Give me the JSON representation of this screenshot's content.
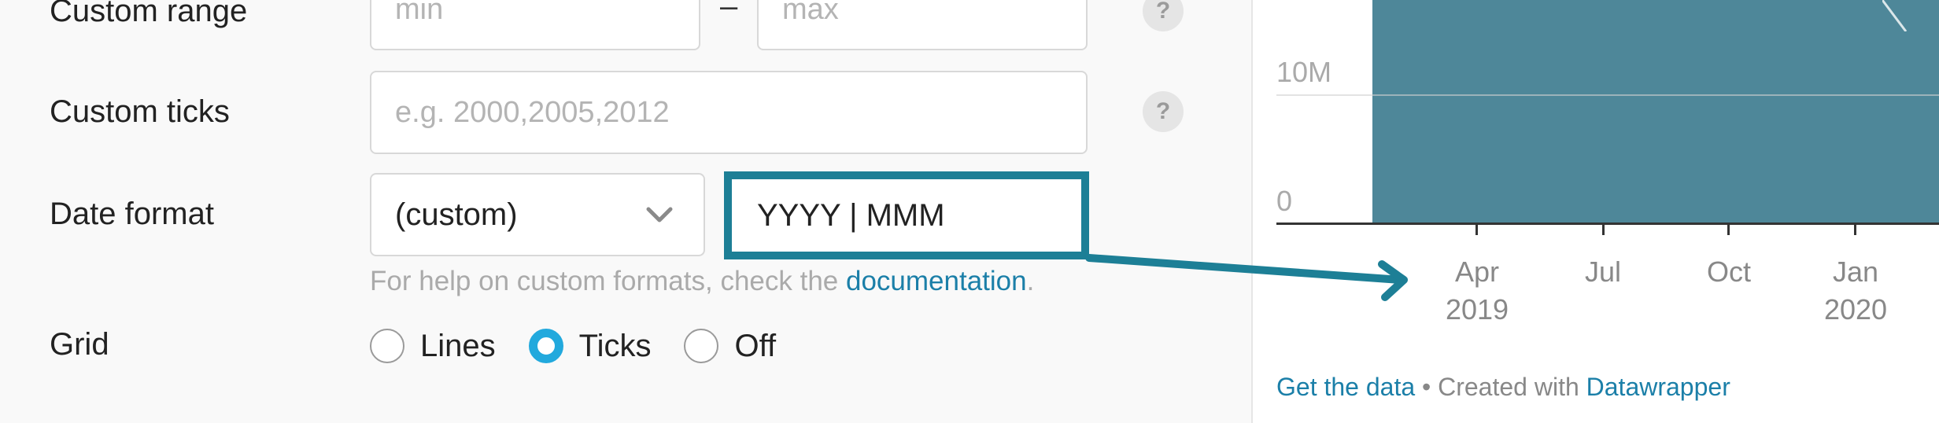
{
  "sidebar": {
    "custom_range": {
      "label": "Custom range",
      "min_placeholder": "min",
      "separator": "–",
      "max_placeholder": "max",
      "help_icon": "?"
    },
    "custom_ticks": {
      "label": "Custom ticks",
      "placeholder": "e.g. 2000,2005,2012",
      "help_icon": "?"
    },
    "date_format": {
      "label": "Date format",
      "select_value": "(custom)",
      "input_value": "YYYY | MMM",
      "hint_prefix": "For help on custom formats, check the ",
      "hint_link": "documentation",
      "hint_suffix": "."
    },
    "grid": {
      "label": "Grid",
      "options": [
        "Lines",
        "Ticks",
        "Off"
      ],
      "selected": "Ticks"
    }
  },
  "preview": {
    "y_labels": {
      "top": "10M",
      "bottom": "0"
    },
    "x_ticks": [
      {
        "line1": "Apr",
        "line2": "2019"
      },
      {
        "line1": "Jul",
        "line2": ""
      },
      {
        "line1": "Oct",
        "line2": ""
      },
      {
        "line1": "Jan",
        "line2": "2020"
      }
    ],
    "footer": {
      "get_data": "Get the data",
      "bullet": "•",
      "created_with": "Created with",
      "tool": "Datawrapper"
    }
  },
  "colors": {
    "accent": "#1d7f96",
    "area_fill": "#4e8799",
    "link": "#1b7fa8",
    "radio_selected": "#22a9dd"
  }
}
